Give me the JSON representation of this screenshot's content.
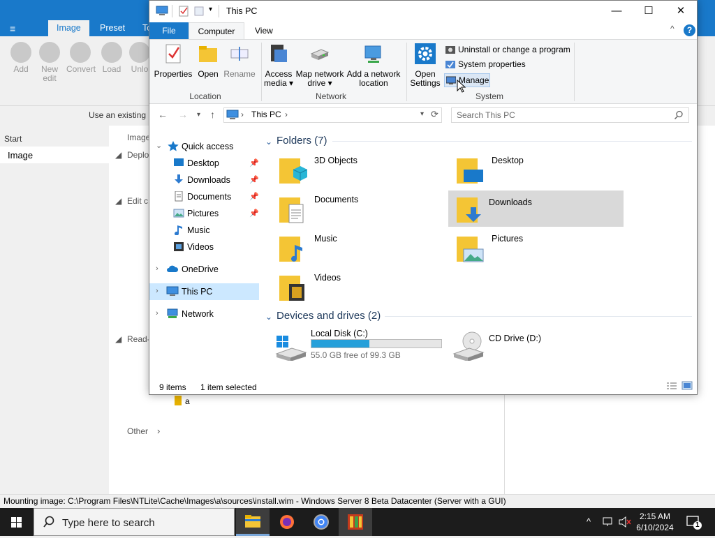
{
  "bg": {
    "menu_glyph": "≡",
    "tabs": [
      "Image",
      "Preset",
      "To"
    ],
    "tools": [
      "Add",
      "New edit",
      "Convert",
      "Load",
      "Unlo"
    ],
    "use_text": "Use an existing i",
    "start": "Start",
    "image_item": "Image",
    "col_header": "Image",
    "tree": [
      "Deplo",
      "Edit c",
      "Read-"
    ],
    "tree_leaf": "a",
    "other": "Other",
    "status": "Mounting image: C:\\Program Files\\NTLite\\Cache\\Images\\a\\sources\\install.wim - Windows Server 8 Beta Datacenter (Server with a GUI)"
  },
  "taskbar": {
    "search_placeholder": "Type here to search",
    "time": "2:15 AM",
    "date": "6/10/2024",
    "notification_count": "1"
  },
  "window": {
    "title": "This PC",
    "controls": {
      "minimize": "—",
      "maximize": "☐",
      "close": "✕"
    },
    "tabs": {
      "file": "File",
      "computer": "Computer",
      "view": "View"
    },
    "ribbon": {
      "properties": "Properties",
      "open": "Open",
      "rename": "Rename",
      "location_group": "Location",
      "access_media_1": "Access",
      "access_media_2": "media ▾",
      "map_drive_1": "Map network",
      "map_drive_2": "drive ▾",
      "add_location_1": "Add a network",
      "add_location_2": "location",
      "network_group": "Network",
      "open_settings_1": "Open",
      "open_settings_2": "Settings",
      "uninstall": "Uninstall or change a program",
      "system_properties": "System properties",
      "manage": "Manage",
      "system_group": "System"
    },
    "address": {
      "path": "This PC",
      "sep": "›"
    },
    "search_placeholder": "Search This PC",
    "nav": {
      "quick_access": "Quick access",
      "items": [
        "Desktop",
        "Downloads",
        "Documents",
        "Pictures",
        "Music",
        "Videos"
      ],
      "onedrive": "OneDrive",
      "this_pc": "This PC",
      "network": "Network"
    },
    "folders_header": "Folders (7)",
    "folders": [
      "3D Objects",
      "Desktop",
      "Documents",
      "Downloads",
      "Music",
      "Pictures",
      "Videos"
    ],
    "drives_header": "Devices and drives (2)",
    "drives": [
      {
        "name": "Local Disk (C:)",
        "free": "55.0 GB free of 99.3 GB",
        "used_fraction": 0.446
      },
      {
        "name": "CD Drive (D:)"
      }
    ],
    "status": {
      "items": "9 items",
      "selected": "1 item selected"
    }
  },
  "colors": {
    "accent": "#1979ca",
    "selection": "#cce8ff",
    "bar": "#26a0da"
  }
}
